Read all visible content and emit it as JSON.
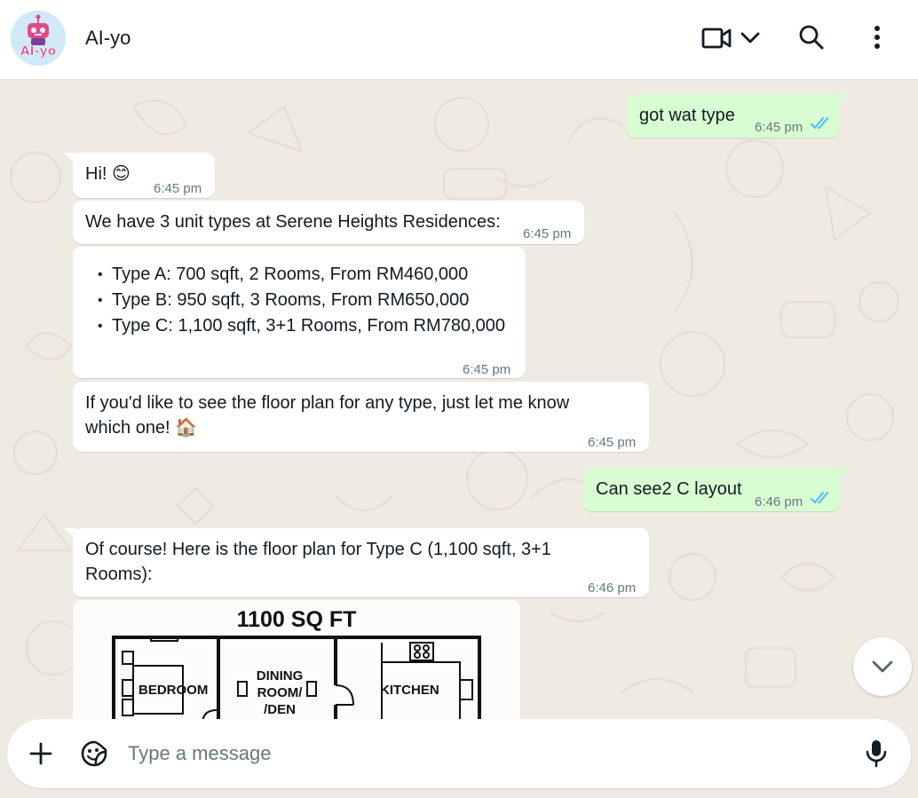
{
  "header": {
    "contact_name": "AI-yo",
    "avatar_text": "AI-yo"
  },
  "messages": {
    "m1": {
      "text": "got wat type",
      "time": "6:45 pm",
      "status": "read"
    },
    "m2": {
      "text": "Hi! 😊",
      "time": "6:45 pm"
    },
    "m3": {
      "text": "We have 3 unit types at Serene Heights Residences:",
      "time": "6:45 pm"
    },
    "m4": {
      "items": [
        "Type A: 700 sqft, 2 Rooms, From RM460,000",
        "Type B: 950 sqft, 3 Rooms, From RM650,000",
        "Type C: 1,100 sqft, 3+1 Rooms, From RM780,000"
      ],
      "time": "6:45 pm"
    },
    "m5": {
      "text": "If you'd like to see the floor plan for any type, just let me know which one! 🏠",
      "time": "6:45 pm"
    },
    "m6": {
      "text": "Can see2 C layout",
      "time": "6:46 pm",
      "status": "read"
    },
    "m7": {
      "text": "Of course! Here is the floor plan for Type C (1,100 sqft, 3+1 Rooms):",
      "time": "6:46 pm"
    },
    "floorplan": {
      "title": "1100 SQ FT",
      "rooms": [
        "BEDROOM",
        "DINING ROOM/ /DEN",
        "KITCHEN"
      ]
    }
  },
  "composer": {
    "placeholder": "Type a message"
  },
  "icons": {
    "video": "video-call-icon",
    "dropdown": "chevron-down-icon",
    "search": "search-icon",
    "menu": "menu-dots-icon",
    "add": "plus-icon",
    "sticker": "sticker-icon",
    "mic": "microphone-icon",
    "scroll": "chevron-down-icon"
  },
  "colors": {
    "incoming_bubble": "#ffffff",
    "outgoing_bubble": "#d9fdd3",
    "chat_background": "#efeae2",
    "read_tick": "#53bdeb",
    "timestamp": "#667781"
  }
}
